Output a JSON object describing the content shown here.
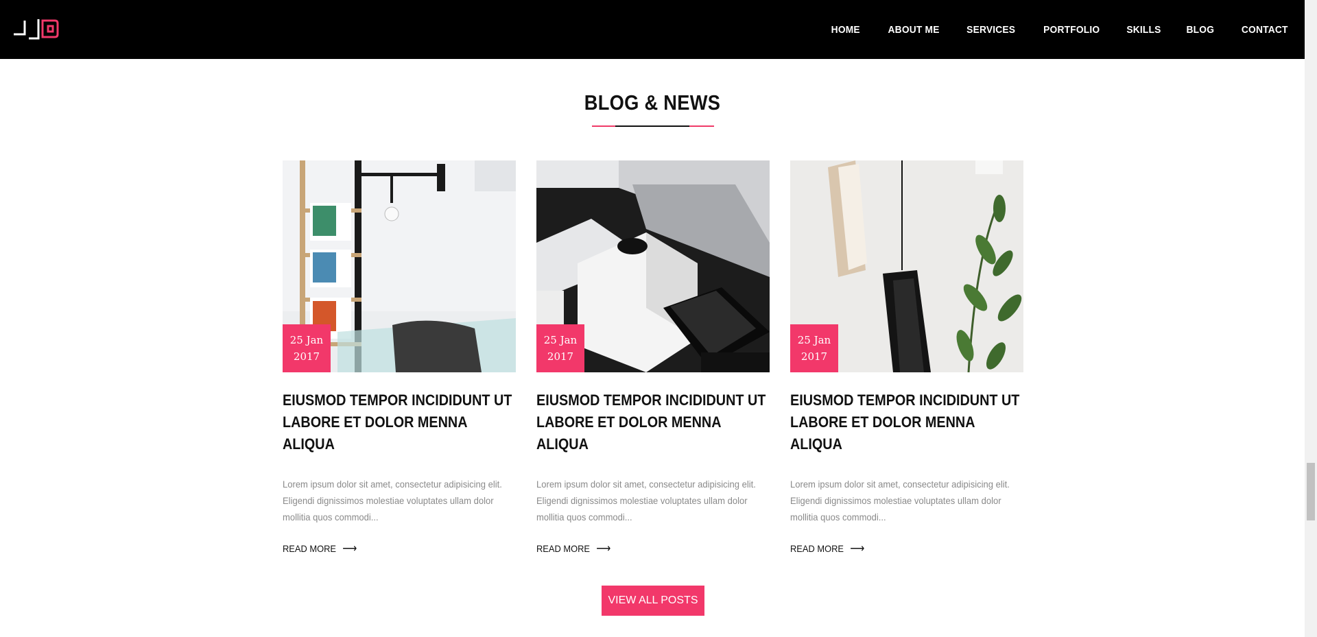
{
  "nav": {
    "items": [
      "HOME",
      "ABOUT ME",
      "SERVICES",
      "PORTFOLIO",
      "SKILLS",
      "BLOG",
      "CONTACT"
    ]
  },
  "section": {
    "title": "BLOG & NEWS",
    "view_all_label": "VIEW ALL POSTS"
  },
  "posts": [
    {
      "date_day": "25 Jan",
      "date_year": "2017",
      "title": "EIUSMOD TEMPOR INCIDIDUNT UT LABORE ET DOLOR MENNA ALIQUA",
      "excerpt": "Lorem ipsum dolor sit amet, consectetur adipisicing elit. Eligendi dignissimos molestiae voluptates ullam dolor mollitia quos commodi...",
      "read_more": "READ MORE"
    },
    {
      "date_day": "25 Jan",
      "date_year": "2017",
      "title": "EIUSMOD TEMPOR INCIDIDUNT UT LABORE ET DOLOR MENNA ALIQUA",
      "excerpt": "Lorem ipsum dolor sit amet, consectetur adipisicing elit. Eligendi dignissimos molestiae voluptates ullam dolor mollitia quos commodi...",
      "read_more": "READ MORE"
    },
    {
      "date_day": "25 Jan",
      "date_year": "2017",
      "title": "EIUSMOD TEMPOR INCIDIDUNT UT LABORE ET DOLOR MENNA ALIQUA",
      "excerpt": "Lorem ipsum dolor sit amet, consectetur adipisicing elit. Eligendi dignissimos molestiae voluptates ullam dolor mollitia quos commodi...",
      "read_more": "READ MORE"
    }
  ],
  "colors": {
    "accent": "#f2386a",
    "header_bg": "#000000"
  },
  "icons": {
    "logo": "jd-logo",
    "arrow": "right-arrow-icon"
  }
}
